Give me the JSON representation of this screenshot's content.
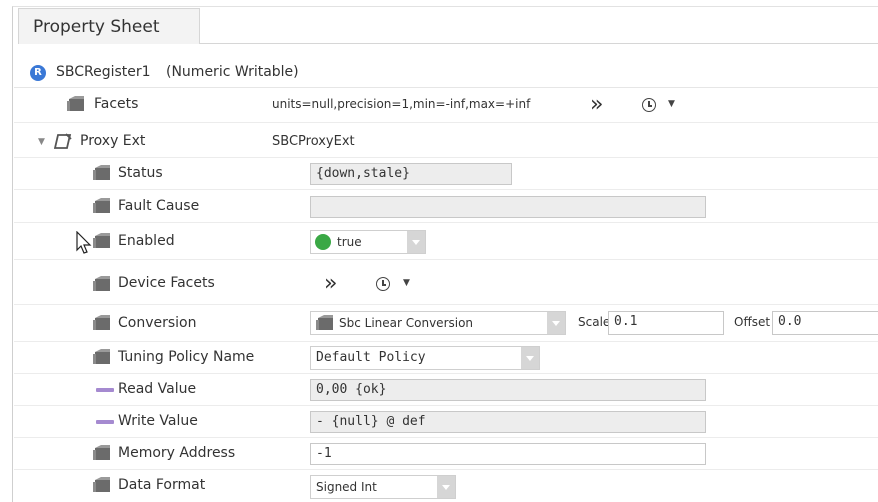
{
  "tab": {
    "title": "Property Sheet"
  },
  "component": {
    "badge": "R",
    "name": "SBCRegister1",
    "type": "(Numeric Writable)"
  },
  "facets": {
    "label": "Facets",
    "value": "units=null,precision=1,min=-inf,max=+inf"
  },
  "proxy_ext": {
    "label": "Proxy Ext",
    "value": "SBCProxyExt"
  },
  "status": {
    "label": "Status",
    "value": "{down,stale}"
  },
  "fault_cause": {
    "label": "Fault Cause",
    "value": ""
  },
  "enabled": {
    "label": "Enabled",
    "value": "true"
  },
  "device_facets": {
    "label": "Device Facets"
  },
  "conversion": {
    "label": "Conversion",
    "value": "Sbc Linear Conversion",
    "scale_label": "Scale",
    "scale_value": "0.1",
    "offset_label": "Offset",
    "offset_value": "0.0"
  },
  "tuning_policy": {
    "label": "Tuning Policy Name",
    "value": "Default Policy"
  },
  "read_value": {
    "label": "Read Value",
    "value": "0,00 {ok}"
  },
  "write_value": {
    "label": "Write Value",
    "value": "- {null} @ def"
  },
  "memory_address": {
    "label": "Memory Address",
    "value": "-1"
  },
  "data_format": {
    "label": "Data Format",
    "value": "Signed Int"
  },
  "colors": {
    "badge": "#3a78d6",
    "enabled_dot": "#3aa845",
    "value_line": "#a58ad0"
  }
}
